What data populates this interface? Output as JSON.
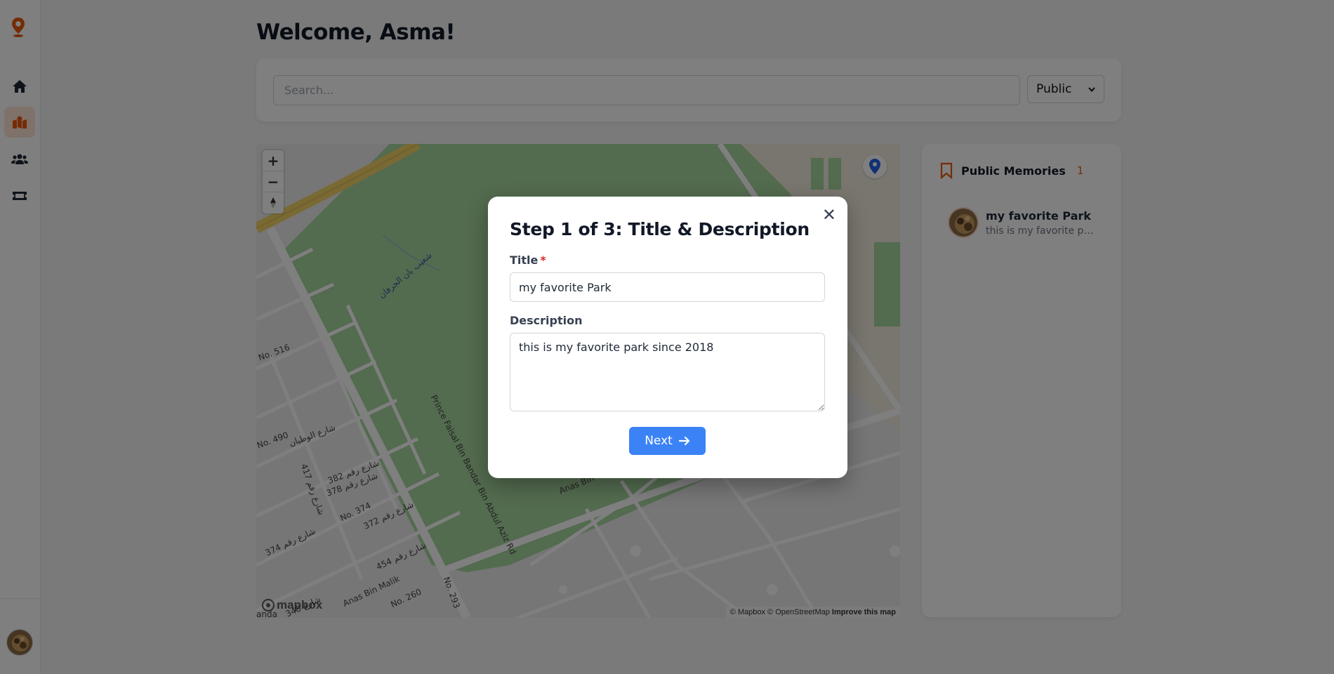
{
  "header": {
    "welcome": "Welcome, Asma!"
  },
  "search": {
    "placeholder": "Search...",
    "value": ""
  },
  "visibility": {
    "selected": "Public"
  },
  "sidebar": {
    "items": [
      {
        "icon": "home-icon"
      },
      {
        "icon": "map-icon",
        "active": true
      },
      {
        "icon": "users-icon"
      },
      {
        "icon": "ticket-icon"
      }
    ],
    "accent": "#ea580c"
  },
  "map": {
    "zoom_in": "+",
    "zoom_out": "−",
    "attribution": "© Mapbox © OpenStreetMap",
    "improve": "Improve this map",
    "logo": "mapbox",
    "labels": {
      "road_main": "Prince Faisal Bin Bandar Bin Abdul Aziz Rd",
      "anas_1": "Anas Bin Malik",
      "anas_2": "Anas Bin",
      "no516": "No. 516",
      "no490": "No. 490",
      "no374": "No. 374",
      "no260": "No. 260",
      "no293": "No. 293",
      "ar_park": "شعيب بان الجرفان",
      "ar_street1": "شارع الوطيان",
      "ar_382": "382 شارع رقم",
      "ar_378": "378 شارع رقم",
      "ar_417": "417 شارع رقم",
      "ar_372": "372 شارع رقم",
      "ar_374": "374 شارع رقم",
      "ar_454": "454 شارع رقم",
      "ar_348": "348 شارع",
      "anda": "anda"
    }
  },
  "memories": {
    "title": "Public Memories",
    "count": "1",
    "items": [
      {
        "name": "my favorite Park",
        "desc": "this is my favorite park since 2018"
      }
    ]
  },
  "modal": {
    "title": "Step 1 of 3: Title & Description",
    "title_label": "Title",
    "required_mark": "*",
    "title_value": "my favorite Park",
    "description_label": "Description",
    "description_value": "this is my favorite park since 2018",
    "next_label": "Next",
    "close": "✕"
  },
  "colors": {
    "primary": "#3b82f6",
    "accent": "#ea580c",
    "park": "#a7d79f"
  }
}
